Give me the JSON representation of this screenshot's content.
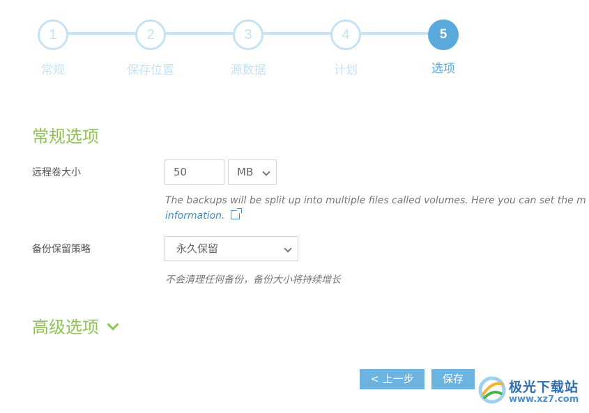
{
  "wizard": {
    "steps": [
      {
        "number": "1",
        "label": "常规",
        "state": "inactive"
      },
      {
        "number": "2",
        "label": "保存位置",
        "state": "inactive"
      },
      {
        "number": "3",
        "label": "源数据",
        "state": "inactive"
      },
      {
        "number": "4",
        "label": "计划",
        "state": "inactive"
      },
      {
        "number": "5",
        "label": "选项",
        "state": "active"
      }
    ]
  },
  "general_options": {
    "title": "常规选项",
    "volume_size": {
      "label": "远程卷大小",
      "value": "50",
      "unit": "MB",
      "hint_text": "The backups will be split up into multiple files called volumes. Here you can set the m",
      "hint_link": "information."
    },
    "retention": {
      "label": "备份保留策略",
      "value": "永久保留",
      "hint_text": "不会清理任何备份，备份大小将持续增长"
    }
  },
  "advanced_options": {
    "title": "高级选项"
  },
  "buttons": {
    "previous": "< 上一步",
    "save": "保存"
  },
  "watermark": {
    "title": "极光下载站",
    "url": "www.xz7.com"
  },
  "colors": {
    "step_active": "#5aa9dc",
    "step_inactive": "#c5e3f4",
    "section_title": "#8fc552",
    "button": "#6cb3e0",
    "link": "#3b8fc4"
  }
}
